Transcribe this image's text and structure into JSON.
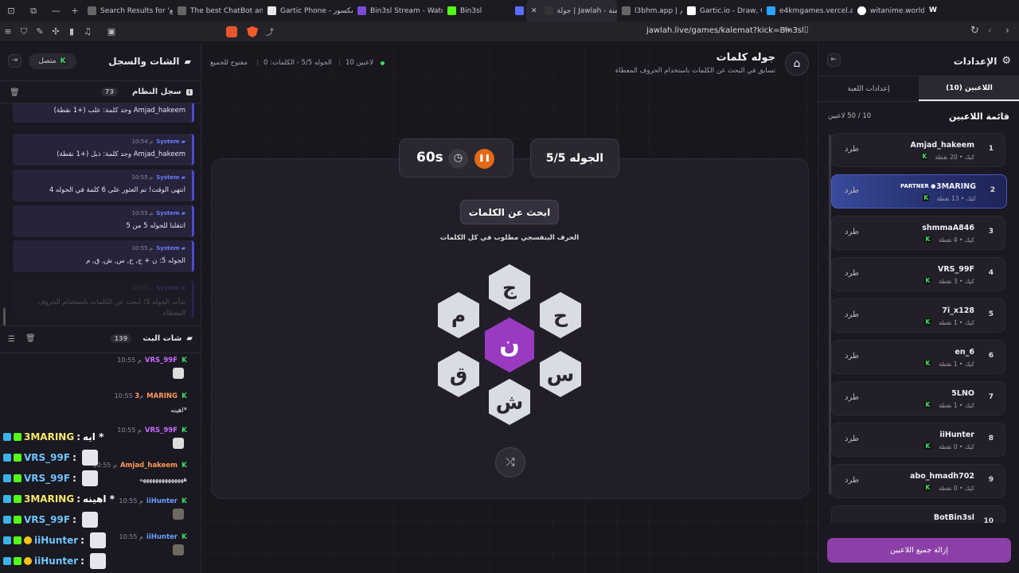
{
  "tabs": [
    {
      "title": "Search Results for 'بيع",
      "color": "#666"
    },
    {
      "title": "The best ChatBot and",
      "color": "#666"
    },
    {
      "title": "Gartic Phone - المكسور",
      "color": "#e8e8e8"
    },
    {
      "title": "Bin3sl Stream - Watch",
      "color": "#7b4bd8"
    },
    {
      "title": "Bin3sl",
      "color": "#53fc18"
    },
    {
      "title": "",
      "color": "#5a6cff"
    },
    {
      "title": "جولة | Jawlah - منة",
      "color": "#333"
    },
    {
      "title": "l3bhm.app | لعبهم",
      "color": "#666"
    },
    {
      "title": "Gartic.io - Draw, Guess",
      "color": "#fff"
    },
    {
      "title": "e4kmgames.vercel.app",
      "color": "#29a3ff"
    },
    {
      "title": "witanime.world",
      "color": "#fff"
    },
    {
      "title": "",
      "color": "#fff"
    }
  ],
  "tab_letters": {
    "witanime": "W"
  },
  "url": "jawlah.live/games/kalemat?kick=Bin3sl",
  "left": {
    "title": "الشات والسجل",
    "status": "متصل",
    "k": "K",
    "log": {
      "title": "سجل النظام",
      "count": "73"
    },
    "system_messages": [
      {
        "name": "",
        "time": "",
        "text": "Amjad_hakeem وجد كلمة: علب (+1 نقطة)"
      },
      {
        "name": "System",
        "time": "10:54 م",
        "text": "Amjad_hakeem وجد كلمة: ذبل (+1 نقطة)"
      },
      {
        "name": "System",
        "time": "10:55 م",
        "text": "انتهى الوقت! تم العثور على 6 كلمة في الجوله 4"
      },
      {
        "name": "System",
        "time": "10:55 م",
        "text": "انتقلنا للجوله 5 من 5"
      },
      {
        "name": "System",
        "time": "10:55 م",
        "text": "الجوله 5: ن + ج, ح, س, ش, ق, م"
      },
      {
        "name": "System",
        "time": "10:55 م",
        "text": "بدأت الجوله 5! ابحث عن الكلمات باستخدام الحروف المعطاة"
      }
    ],
    "chat": {
      "title": "شات البث",
      "count": "139"
    },
    "chat_messages": [
      {
        "name": "VRS_99F",
        "time": "10:55 م",
        "text": "",
        "color": "#c96bff"
      },
      {
        "name": "3MARING",
        "time": "10:55 م",
        "text": "اهينه*",
        "color": "#ff9a5b"
      },
      {
        "name": "VRS_99F",
        "time": "10:55 م",
        "text": "",
        "color": "#c96bff"
      },
      {
        "name": "Amjad_hakeem",
        "time": "10:55 م",
        "text": "ههههههههههههههه",
        "color": "#ff9a5b"
      },
      {
        "name": "iiHunter",
        "time": "10:55 م",
        "text": "",
        "color": "#6b9fff"
      },
      {
        "name": "iiHunter",
        "time": "10:55 م",
        "text": "",
        "color": "#6b9fff"
      }
    ],
    "overlay": [
      {
        "name": "3MARING",
        "text": "ايه *",
        "color": "#f5e86a"
      },
      {
        "name": "VRS_99F",
        "text": "",
        "color": "#6fc4ff"
      },
      {
        "name": "VRS_99F",
        "text": "",
        "color": "#6fc4ff"
      },
      {
        "name": "3MARING",
        "text": "اهينه *",
        "color": "#f5e86a"
      },
      {
        "name": "VRS_99F",
        "text": "",
        "color": "#6fc4ff"
      },
      {
        "name": "iiHunter",
        "text": "",
        "color": "#6fc4ff"
      },
      {
        "name": "iiHunter",
        "text": "",
        "color": "#6fc4ff"
      }
    ]
  },
  "game": {
    "title": "جوله كلمات",
    "subtitle": "تسابق في البحث عن الكلمات باستخدام الحروف المعطاة",
    "players_count": "10 لاعبين",
    "round_info": "الجوله 5/5 - الكلمات: 0",
    "open": "مفتوح للجميع",
    "round_badge": "الجوله 5/5",
    "timer": "60s",
    "find_words": "ابحث عن الكلمات",
    "hint": "الحرف البنفسجي مطلوب في كل الكلمات",
    "center_letter": "ن",
    "letters": [
      "ج",
      "ح",
      "س",
      "ش",
      "ق",
      "م"
    ]
  },
  "right": {
    "title": "الإعدادات",
    "tab_players": "اللاعبين (10)",
    "tab_game": "إعدادات اللعبة",
    "list_title": "قائمة اللاعبين",
    "list_count": "10 / 50 لاعبين",
    "kick_label": "طرد",
    "partner": "PARTNER",
    "remove_all": "إزالة جميع اللاعبين",
    "players": [
      {
        "num": "1",
        "name": "Amjad_hakeem",
        "sub": "كيك • 20 نقطة"
      },
      {
        "num": "2",
        "name": "3MARING",
        "sub": "كيك • 13 نقطة"
      },
      {
        "num": "3",
        "name": "shmmaA846",
        "sub": "كيك • 4 نقطة"
      },
      {
        "num": "4",
        "name": "VRS_99F",
        "sub": "كيك • 3 نقطة"
      },
      {
        "num": "5",
        "name": "7i_x128",
        "sub": "كيك • 1 نقطة"
      },
      {
        "num": "6",
        "name": "en_6",
        "sub": "كيك • 1 نقطة"
      },
      {
        "num": "7",
        "name": "5LNO",
        "sub": "كيك • 1 نقطة"
      },
      {
        "num": "8",
        "name": "iiHunter",
        "sub": "كيك • 0 نقطة"
      },
      {
        "num": "9",
        "name": "abo_hmadh702",
        "sub": "كيك • 0 نقطة"
      },
      {
        "num": "10",
        "name": "BotBin3sl",
        "sub": ""
      }
    ]
  }
}
